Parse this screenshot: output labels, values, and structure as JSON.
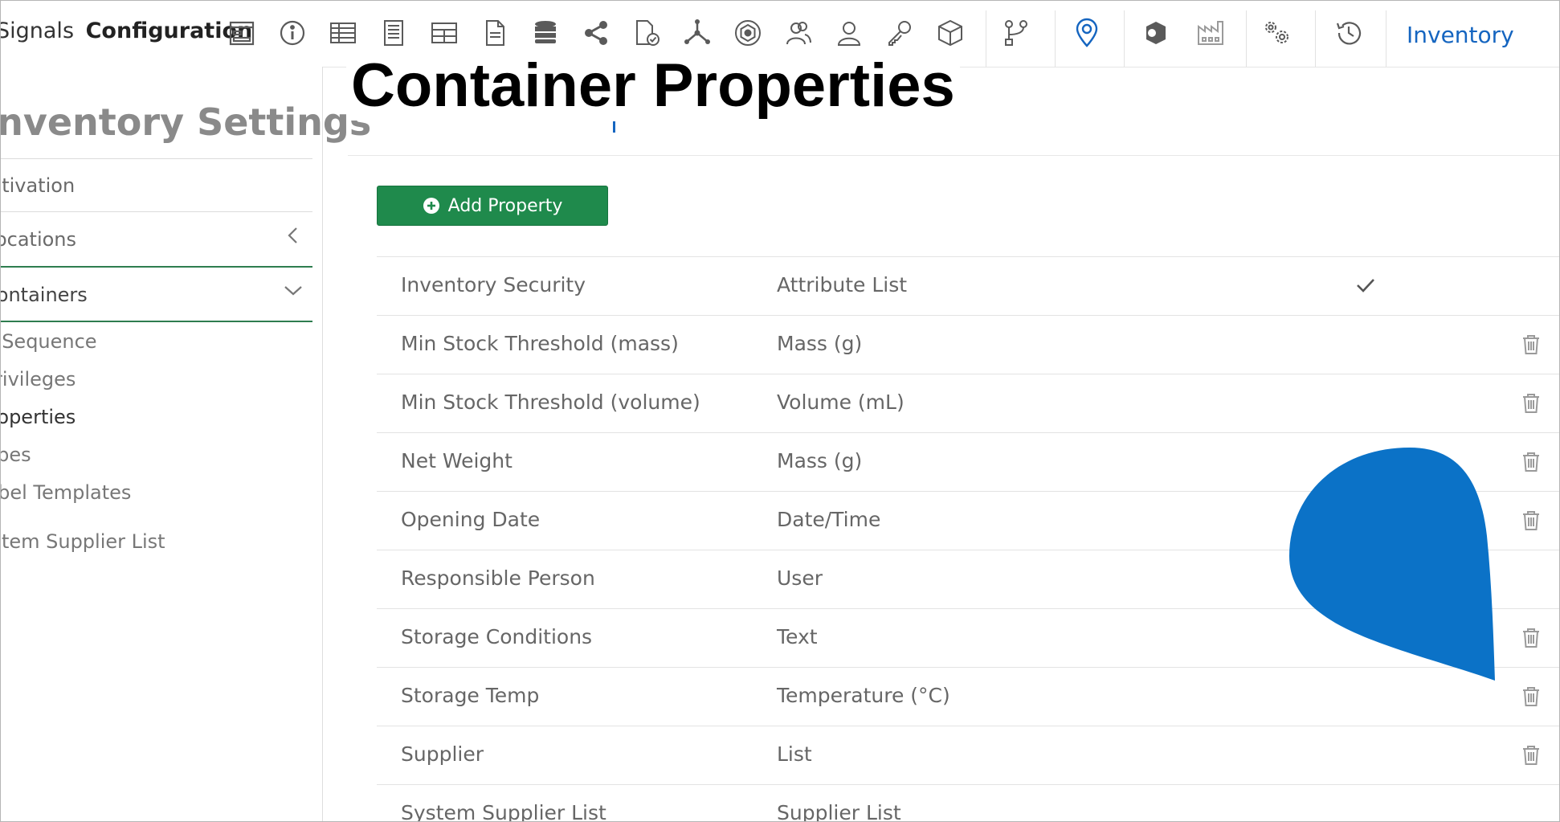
{
  "app": {
    "brand_light": "Signals",
    "brand_bold": "Configuration",
    "nav_link": "Inventory"
  },
  "toolbar": {
    "icons": [
      "form-icon",
      "info-icon",
      "table-icon",
      "notebook-icon",
      "grid-icon",
      "document-icon",
      "database-icon",
      "share-icon",
      "document-check-icon",
      "network-icon",
      "hexagon-icon",
      "users-icon",
      "user-icon",
      "key-icon",
      "cube-icon",
      "workflow-icon",
      "location-pin-icon",
      "shield-icon",
      "factory-icon",
      "settings-gears-icon",
      "history-icon"
    ]
  },
  "page": {
    "heading": "Container Properties"
  },
  "sidebar": {
    "title": "Inventory Settings",
    "items": [
      {
        "label": "Activation"
      },
      {
        "label": "Locations"
      },
      {
        "label": "Containers"
      }
    ],
    "sub_items": [
      {
        "label": "ID Sequence"
      },
      {
        "label": "Privileges"
      },
      {
        "label": "Properties",
        "active": true
      },
      {
        "label": "Types"
      },
      {
        "label": "Label Templates"
      },
      {
        "label": "System Supplier List"
      }
    ]
  },
  "main": {
    "add_button_label": "Add Property",
    "properties": [
      {
        "name": "Inventory Security",
        "type": "Attribute List",
        "checked": true,
        "deletable": false
      },
      {
        "name": "Min Stock Threshold (mass)",
        "type": "Mass (g)",
        "checked": false,
        "deletable": true
      },
      {
        "name": "Min Stock Threshold (volume)",
        "type": "Volume (mL)",
        "checked": false,
        "deletable": true
      },
      {
        "name": "Net Weight",
        "type": "Mass (g)",
        "checked": false,
        "deletable": true
      },
      {
        "name": "Opening Date",
        "type": "Date/Time",
        "checked": false,
        "deletable": true
      },
      {
        "name": "Responsible Person",
        "type": "User",
        "checked": false,
        "deletable": false
      },
      {
        "name": "Storage Conditions",
        "type": "Text",
        "checked": false,
        "deletable": true
      },
      {
        "name": "Storage Temp",
        "type": "Temperature (°C)",
        "checked": false,
        "deletable": true
      },
      {
        "name": "Supplier",
        "type": "List",
        "checked": false,
        "deletable": true
      },
      {
        "name": "System Supplier List",
        "type": "Supplier List",
        "checked": false,
        "deletable": false
      }
    ]
  },
  "colors": {
    "accent_blue": "#1565c0",
    "button_green": "#1f8a4c",
    "overlay_blue": "#0b72c7"
  }
}
